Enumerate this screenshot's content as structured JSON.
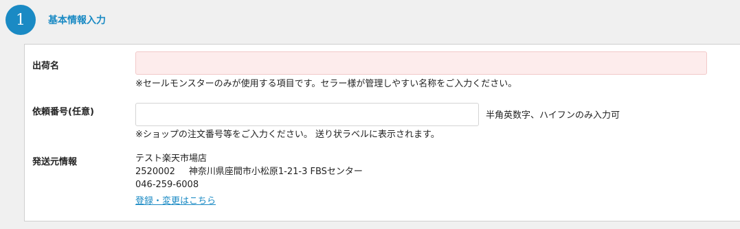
{
  "section": {
    "step": "1",
    "title": "基本情報入力"
  },
  "shipment_name": {
    "label": "出荷名",
    "value": "",
    "note": "※セールモンスターのみが使用する項目です。セラー様が管理しやすい名称をご入力ください。"
  },
  "request_number": {
    "label": "依頼番号(任意)",
    "value": "",
    "hint": "半角英数字、ハイフンのみ入力可",
    "note": "※ショップの注文番号等をご入力ください。 送り状ラベルに表示されます。"
  },
  "sender": {
    "label": "発送元情報",
    "name": "テスト楽天市場店",
    "postal": "2520002",
    "address": "神奈川県座間市小松原1-21-3 FBSセンター",
    "phone": "046-259-6008",
    "link": "登録・変更はこちら"
  },
  "colors": {
    "accent": "#1a8ac4",
    "error_bg": "#fdecec"
  }
}
